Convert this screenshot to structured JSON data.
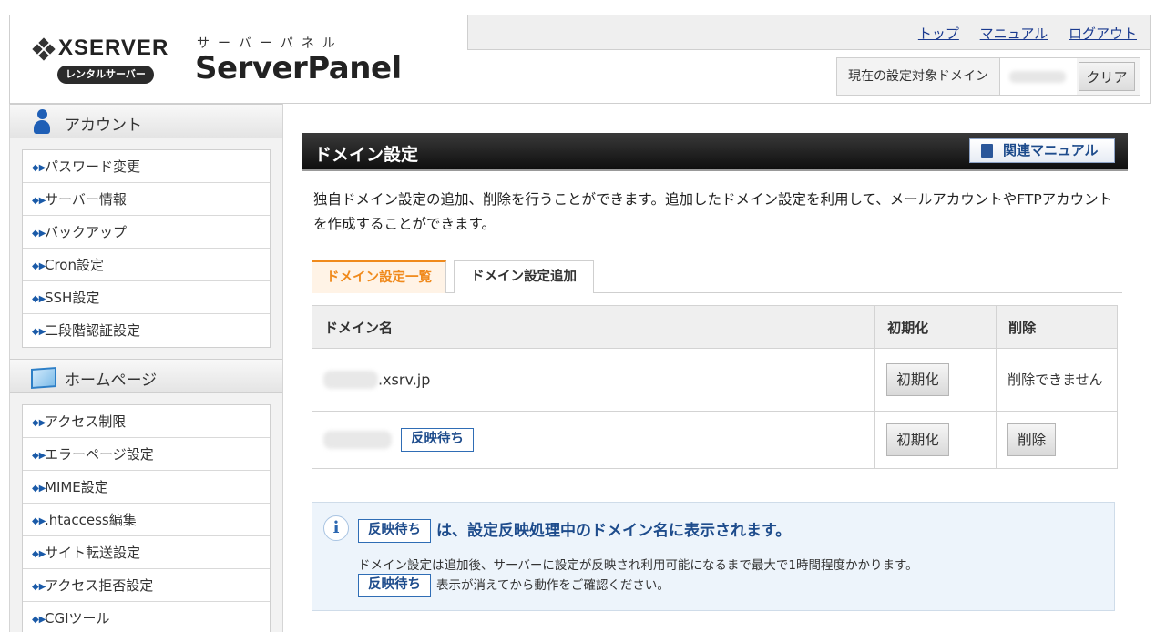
{
  "header": {
    "logo_word": "XSERVER",
    "logo_badge": "レンタルサーバー",
    "panel_kana": "サーバーパネル",
    "panel_title": "ServerPanel",
    "links": [
      "トップ",
      "マニュアル",
      "ログアウト"
    ],
    "domain_label": "現在の設定対象ドメイン",
    "clear_button": "クリア"
  },
  "sidebar": {
    "sections": [
      {
        "title": "アカウント",
        "icon": "person-icon",
        "items": [
          "パスワード変更",
          "サーバー情報",
          "バックアップ",
          "Cron設定",
          "SSH設定",
          "二段階認証設定"
        ]
      },
      {
        "title": "ホームページ",
        "icon": "window-icon",
        "items": [
          "アクセス制限",
          "エラーページ設定",
          "MIME設定",
          ".htaccess編集",
          "サイト転送設定",
          "アクセス拒否設定",
          "CGIツール"
        ]
      }
    ]
  },
  "main": {
    "title": "ドメイン設定",
    "manual_button": "関連マニュアル",
    "description": "独自ドメイン設定の追加、削除を行うことができます。追加したドメイン設定を利用して、メールアカウントやFTPアカウントを作成することができます。",
    "tabs": [
      "ドメイン設定一覧",
      "ドメイン設定追加"
    ],
    "table": {
      "headers": [
        "ドメイン名",
        "初期化",
        "削除"
      ],
      "rows": [
        {
          "domain_suffix": ".xsrv.jp",
          "init_button": "初期化",
          "delete_text": "削除できません"
        },
        {
          "badge": "反映待ち",
          "init_button": "初期化",
          "delete_button": "削除"
        }
      ]
    },
    "info": {
      "badge": "反映待ち",
      "heading": "は、設定反映処理中のドメイン名に表示されます。",
      "line1": "ドメイン設定は追加後、サーバーに設定が反映され利用可能になるまで最大で1時間程度かかります。",
      "line2": "表示が消えてから動作をご確認ください。"
    }
  }
}
